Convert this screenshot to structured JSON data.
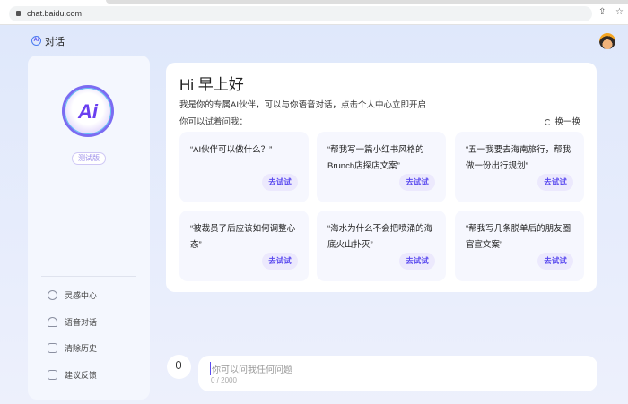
{
  "browser": {
    "url": "chat.baidu.com"
  },
  "header": {
    "logo": "Ai",
    "title": "对话"
  },
  "sidebar": {
    "logo": "Ai",
    "badge": "测试版",
    "items": [
      {
        "label": "灵感中心",
        "icon": "lightbulb-icon"
      },
      {
        "label": "语音对话",
        "icon": "headphones-icon"
      },
      {
        "label": "清除历史",
        "icon": "trash-icon"
      },
      {
        "label": "建议反馈",
        "icon": "feedback-icon"
      }
    ]
  },
  "main": {
    "greeting": "Hi 早上好",
    "intro": "我是你的专属AI伙伴，可以与你语音对话，点击个人中心立即开启",
    "try_ask": "你可以试着问我：",
    "refresh": "换一换",
    "suggestions": [
      {
        "text": "“AI伙伴可以做什么？”",
        "button": "去试试"
      },
      {
        "text": "“帮我写一篇小红书风格的Brunch店探店文案”",
        "button": "去试试"
      },
      {
        "text": "“五一我要去海南旅行，帮我做一份出行规划”",
        "button": "去试试"
      },
      {
        "text": "“被裁员了后应该如何调整心态”",
        "button": "去试试"
      },
      {
        "text": "“海水为什么不会把喷涌的海底火山扑灭”",
        "button": "去试试"
      },
      {
        "text": "“帮我写几条脱单后的朋友圈官宣文案”",
        "button": "去试试"
      }
    ]
  },
  "input": {
    "placeholder": "你可以问我任何问题",
    "counter": "0 / 2000"
  }
}
